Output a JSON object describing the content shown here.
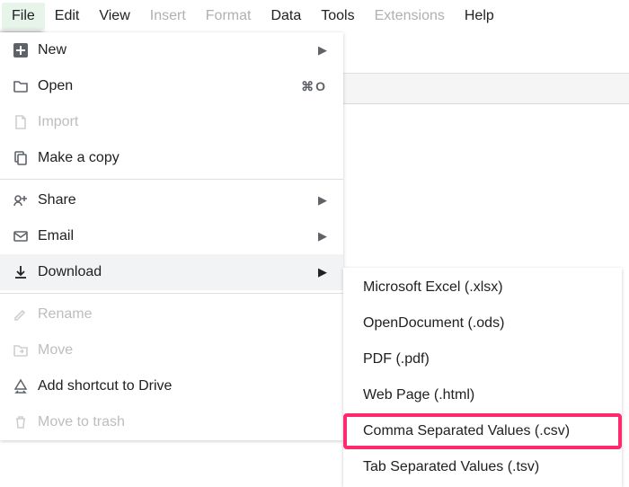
{
  "menubar": {
    "items": [
      {
        "label": "File",
        "active": true
      },
      {
        "label": "Edit"
      },
      {
        "label": "View"
      },
      {
        "label": "Insert",
        "disabled": true
      },
      {
        "label": "Format",
        "disabled": true
      },
      {
        "label": "Data"
      },
      {
        "label": "Tools"
      },
      {
        "label": "Extensions",
        "disabled": true
      },
      {
        "label": "Help"
      }
    ]
  },
  "file_menu": {
    "new": "New",
    "open": "Open",
    "open_shortcut": "⌘O",
    "import": "Import",
    "make_copy": "Make a copy",
    "share": "Share",
    "email": "Email",
    "download": "Download",
    "rename": "Rename",
    "move": "Move",
    "add_shortcut": "Add shortcut to Drive",
    "move_trash": "Move to trash"
  },
  "download_submenu": {
    "items": [
      {
        "label": "Microsoft Excel (.xlsx)"
      },
      {
        "label": "OpenDocument (.ods)"
      },
      {
        "label": "PDF (.pdf)"
      },
      {
        "label": "Web Page (.html)"
      },
      {
        "label": "Comma Separated Values (.csv)",
        "highlighted": true
      },
      {
        "label": "Tab Separated Values (.tsv)"
      }
    ]
  },
  "colors": {
    "highlight_border": "#ff2a6d"
  }
}
